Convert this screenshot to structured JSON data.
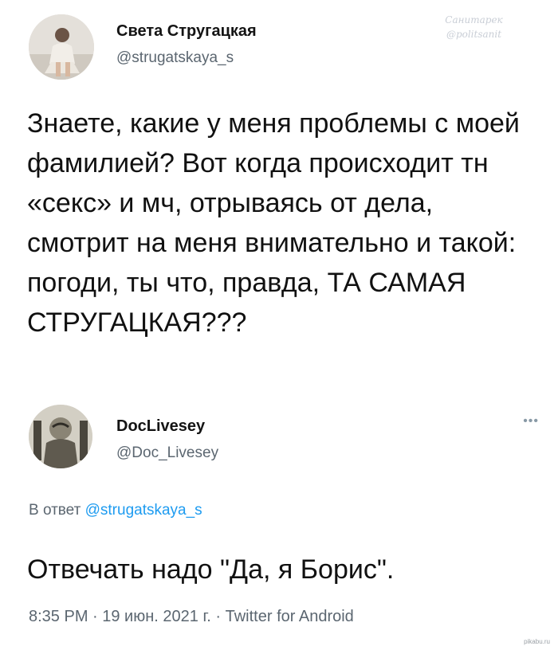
{
  "watermark": {
    "line1": "Санитарек",
    "line2": "@politsanit"
  },
  "tweet1": {
    "name": "Света Стругацкая",
    "handle": "@strugatskaya_s",
    "text": "Знаете, какие у меня проблемы с моей фамилией? Вот когда происходит тн «секс» и мч, отрываясь от дела, смотрит на меня внимательно и такой: погоди, ты что, правда, ТА САМАЯ СТРУГАЦКАЯ???"
  },
  "tweet2": {
    "name": "DocLivesey",
    "handle": "@Doc_Livesey",
    "more_label": "•••",
    "reply_prefix": "В ответ",
    "reply_handle": "@strugatskaya_s",
    "text": "Отвечать надо \"Да, я Борис\".",
    "meta": "8:35 PM · 19 июн. 2021 г. · Twitter for Android"
  },
  "source": "pikabu.ru",
  "icons": {
    "avatar1": "user-photo-avatar",
    "avatar2": "doctor-portrait-avatar",
    "more": "more-dots-icon",
    "watermark": "watermark-logo"
  }
}
